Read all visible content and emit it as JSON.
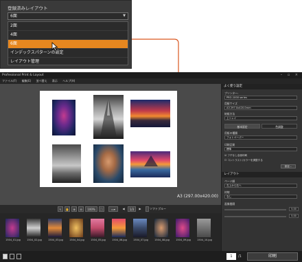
{
  "dropdown": {
    "title": "登録済みレイアウト",
    "selected": "6面",
    "options": [
      "2面",
      "4面",
      "6面",
      "インデックスパターンの設定",
      "レイアウト管理"
    ],
    "selected_index": 2
  },
  "window": {
    "title": "Professional Print & Layout",
    "buttons": "– ▫ ×"
  },
  "menu": [
    "ファイル(F)",
    "編集(E)",
    "並べ替え",
    "表示",
    "ヘルプ(H)"
  ],
  "paper_size": "A3 (297.00x420.00)",
  "toolbar": {
    "zoom_level": "100%",
    "page_indicator": "1/3",
    "soft_proof_label": "ソフトプルーフ"
  },
  "filmstrip": [
    "1504_01.jpg",
    "1504_02.jpg",
    "1504_03.jpg",
    "1504_04.jpg",
    "1504_05.jpg",
    "1504_06.jpg",
    "1504_07.jpg",
    "1504_08.jpg",
    "1504_09.jpg",
    "1504_10.jpg"
  ],
  "status": {
    "page_value": "1",
    "page_total": "/1",
    "print_label": "印刷"
  },
  "panel": {
    "header_main": "よく使う設定",
    "printer_label": "プリンター:",
    "printer_value": "PRO-1000 series",
    "paper_label": "用紙サイズ",
    "paper_value": "A3 297.0x420.0mm",
    "source_label": "給紙方法",
    "source_value": "上トレイ",
    "tabs": [
      "基本設定",
      "色調整"
    ],
    "media_label": "用紙の種類",
    "media_value": "フォトペーパー",
    "quality_label": "印刷品質",
    "quality_value": "標準",
    "check1": "フチなし全面印刷",
    "check2": "コントラスト/カラーを調整する",
    "settings_button": "設定...",
    "header_layout": "レイアウト",
    "layout_label": "ページ順",
    "layout_value": "左上から右へ",
    "frame_label": "枠線",
    "frame_value": "なし",
    "spacing_label": "画像間隔",
    "spacing_value_a": "5.00",
    "spacing_value_b": "5.00"
  },
  "colors": {
    "accent": "#e7871f",
    "arrow": "#d9561f",
    "panel_bg": "#333333",
    "canvas_bg": "#4a4a4a"
  }
}
